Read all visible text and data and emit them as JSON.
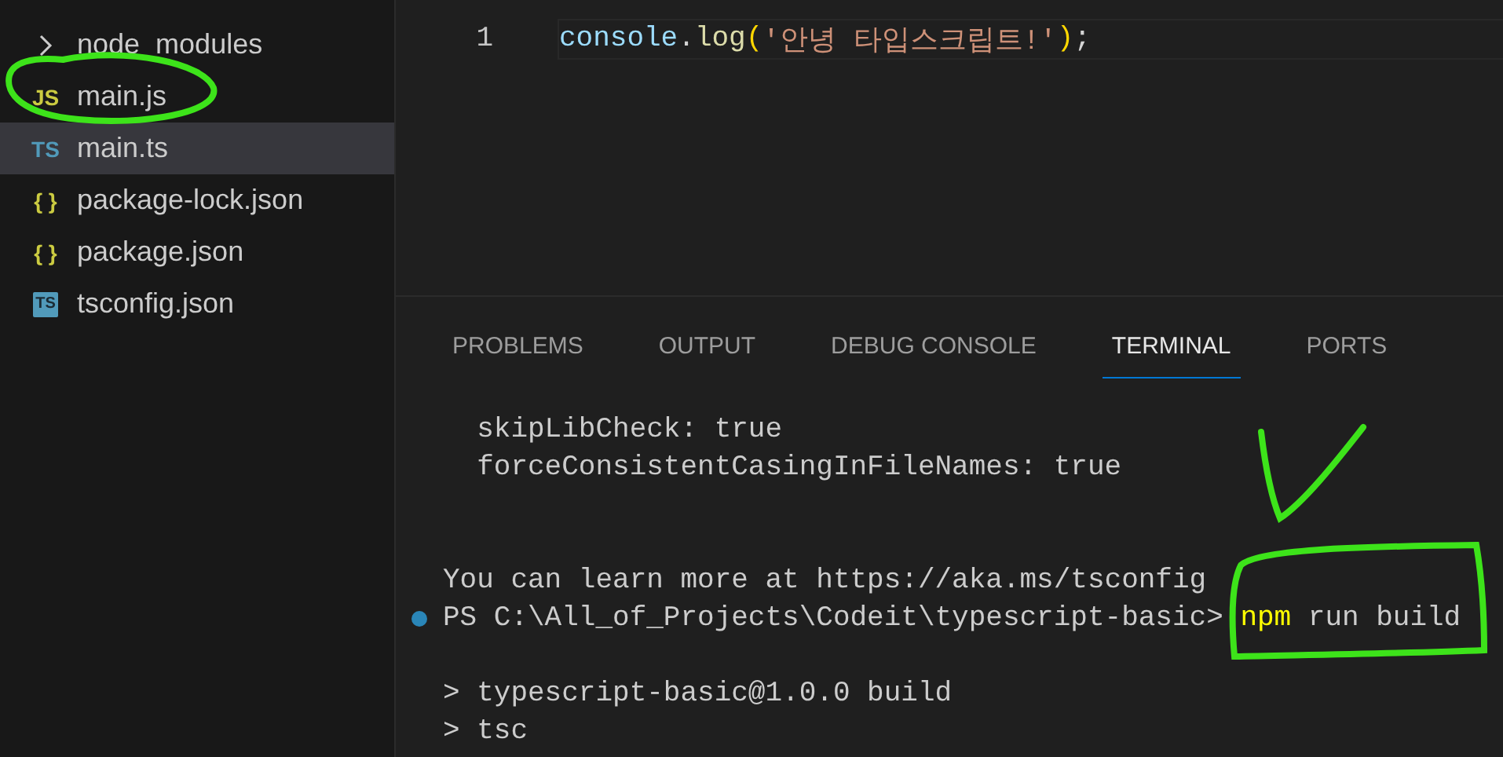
{
  "explorer": {
    "items": [
      {
        "name": "node_modules",
        "kind": "folder",
        "expanded": false,
        "selected": false
      },
      {
        "name": "main.js",
        "kind": "js",
        "icon": "JS",
        "selected": false
      },
      {
        "name": "main.ts",
        "kind": "ts",
        "icon": "TS",
        "selected": true
      },
      {
        "name": "package-lock.json",
        "kind": "json",
        "icon": "{ }",
        "selected": false
      },
      {
        "name": "package.json",
        "kind": "json",
        "icon": "{ }",
        "selected": false
      },
      {
        "name": "tsconfig.json",
        "kind": "tsconfig",
        "icon": "TS",
        "selected": false
      }
    ]
  },
  "editor": {
    "lines": [
      {
        "number": "1",
        "tokens": [
          {
            "kind": "variable",
            "text": "console"
          },
          {
            "kind": "punct",
            "text": "."
          },
          {
            "kind": "function",
            "text": "log"
          },
          {
            "kind": "bracket",
            "text": "("
          },
          {
            "kind": "string",
            "text": "'안녕 타입스크립트!'"
          },
          {
            "kind": "bracket",
            "text": ")"
          },
          {
            "kind": "punct",
            "text": ";"
          }
        ]
      }
    ]
  },
  "panel": {
    "tabs": [
      {
        "label": "PROBLEMS",
        "selected": false
      },
      {
        "label": "OUTPUT",
        "selected": false
      },
      {
        "label": "DEBUG CONSOLE",
        "selected": false
      },
      {
        "label": "TERMINAL",
        "selected": true
      },
      {
        "label": "PORTS",
        "selected": false
      }
    ]
  },
  "terminal": {
    "lines": [
      {
        "kind": "output",
        "text": "  skipLibCheck: true"
      },
      {
        "kind": "output",
        "text": "  forceConsistentCasingInFileNames: true"
      },
      {
        "kind": "blank"
      },
      {
        "kind": "blank"
      },
      {
        "kind": "output",
        "text": "You can learn more at https://aka.ms/tsconfig"
      },
      {
        "kind": "prompt",
        "prompt": "PS C:\\All_of_Projects\\Codeit\\typescript-basic>",
        "command": "npm",
        "args": "run build"
      },
      {
        "kind": "blank"
      },
      {
        "kind": "output",
        "text": "> typescript-basic@1.0.0 build"
      },
      {
        "kind": "output",
        "text": "> tsc"
      }
    ]
  },
  "annotations": [
    {
      "kind": "ellipse"
    },
    {
      "kind": "check"
    },
    {
      "kind": "box"
    }
  ]
}
